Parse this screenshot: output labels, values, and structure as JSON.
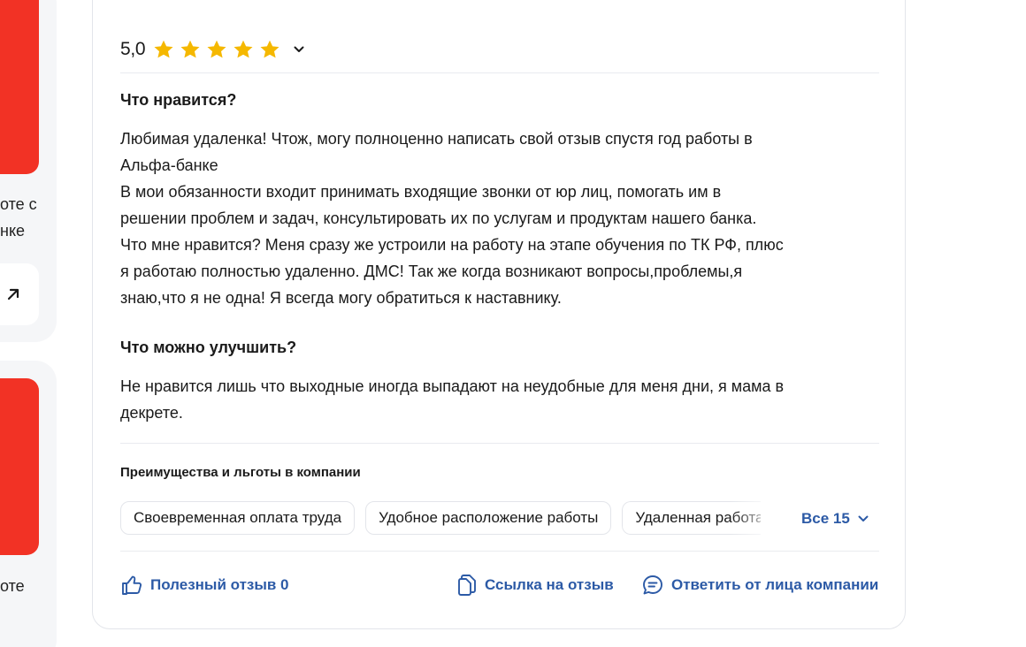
{
  "left_cards": [
    {
      "lines": [
        "оте с",
        "нке"
      ]
    },
    {
      "lines": [
        "оте"
      ]
    }
  ],
  "review": {
    "rating_value": "5,0",
    "stars": 5,
    "pros": {
      "title": "Что нравится?",
      "text": "Любимая удаленка! Чтож, могу полноценно написать свой отзыв спустя год работы в\nАльфа-банке\nВ мои обязанности входит принимать входящие звонки от юр лиц, помогать им в\nрешении проблем и задач, консультировать их по услугам и продуктам нашего банка.\nЧто мне нравится? Меня сразу же устроили на работу на этапе обучения по ТК РФ, плюс\nя работаю полностью удаленно. ДМС! Так же когда возникают вопросы,проблемы,я\nзнаю,что я не одна! Я всегда могу обратиться к наставнику."
    },
    "cons": {
      "title": "Что можно улучшить?",
      "text": "Не нравится лишь что выходные иногда выпадают на неудобные для меня дни, я мама в\nдекрете."
    },
    "benefits": {
      "title": "Преимущества и льготы в компании",
      "chips": [
        "Своевременная оплата труда",
        "Удобное расположение работы",
        "Удаленная работа"
      ],
      "all_label": "Все 15"
    },
    "actions": {
      "helpful": "Полезный отзыв 0",
      "link": "Ссылка на отзыв",
      "reply": "Ответить от лица компании"
    }
  },
  "colors": {
    "accent": "#2c5aa6",
    "star": "#f5b800",
    "brand_red": "#f23225"
  },
  "icons": [
    "star-icon",
    "chevron-down-icon",
    "arrow-up-right-icon",
    "thumbs-up-icon",
    "copy-link-icon",
    "chat-bubble-icon"
  ]
}
